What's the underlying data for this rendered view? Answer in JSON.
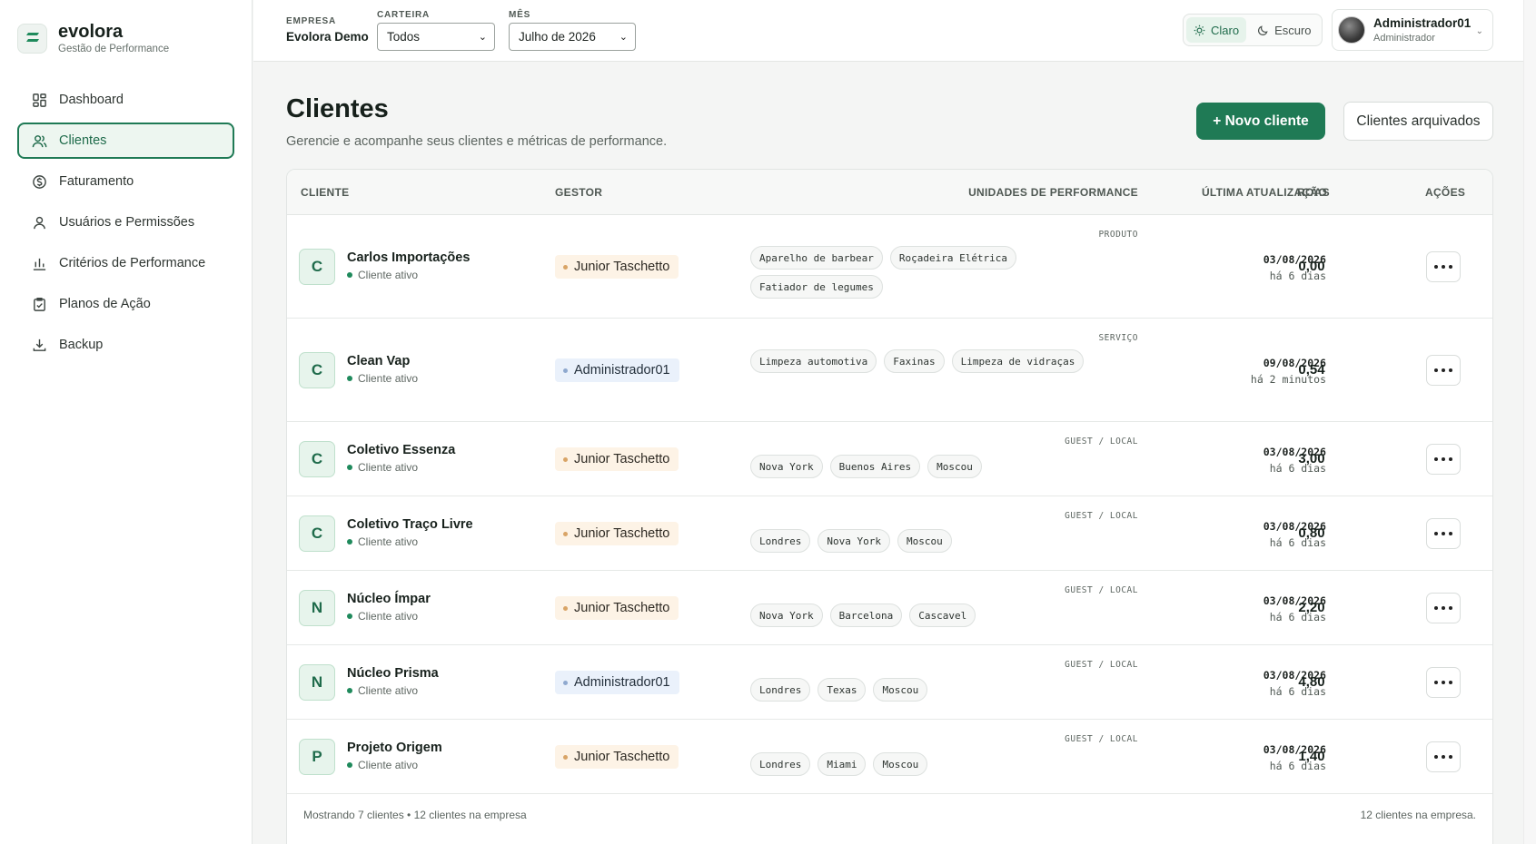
{
  "brand": {
    "name": "evolora",
    "subtitle": "Gestão de Performance"
  },
  "sidebar": {
    "items": [
      {
        "label": "Dashboard",
        "icon": "grid-icon",
        "active": false
      },
      {
        "label": "Clientes",
        "icon": "users-icon",
        "active": true
      },
      {
        "label": "Faturamento",
        "icon": "dollar-circle-icon",
        "active": false
      },
      {
        "label": "Usuários e Permissões",
        "icon": "user-icon",
        "active": false
      },
      {
        "label": "Critérios de Performance",
        "icon": "bar-chart-icon",
        "active": false
      },
      {
        "label": "Planos de Ação",
        "icon": "clipboard-check-icon",
        "active": false
      },
      {
        "label": "Backup",
        "icon": "download-icon",
        "active": false
      }
    ]
  },
  "topbar": {
    "empresa_label": "EMPRESA",
    "empresa_value": "Evolora Demo",
    "carteira_label": "CARTEIRA",
    "carteira_value": "Todos",
    "mes_label": "MÊS",
    "mes_value": "Julho de 2026",
    "theme_light": "Claro",
    "theme_dark": "Escuro",
    "user_name": "Administrador01",
    "user_role": "Administrador"
  },
  "page": {
    "title": "Clientes",
    "subtitle": "Gerencie e acompanhe seus clientes e métricas de performance.",
    "new_button": "+ Novo cliente",
    "archived_button": "Clientes arquivados"
  },
  "table": {
    "headers": {
      "cliente": "CLIENTE",
      "gestor": "GESTOR",
      "unidades": "UNIDADES DE PERFORMANCE",
      "atualizacao": "ÚLTIMA ATUALIZAÇÃO",
      "roas": "ROAS",
      "acoes": "AÇÕES"
    },
    "rows": [
      {
        "initial": "C",
        "name": "Carlos Importações",
        "status": "Cliente ativo",
        "gestor": "Junior Taschetto",
        "gestor_color": "orange",
        "unit_type": "PRODUTO",
        "units": [
          "Aparelho de barbear",
          "Roçadeira Elétrica",
          "Fatiador de legumes"
        ],
        "date": "03/08/2026",
        "ago": "há 6 dias",
        "roas": "0,00"
      },
      {
        "initial": "C",
        "name": "Clean Vap",
        "status": "Cliente ativo",
        "gestor": "Administrador01",
        "gestor_color": "blue",
        "unit_type": "SERVIÇO",
        "units": [
          "Limpeza automotiva",
          "Faxinas",
          "Limpeza de vidraças"
        ],
        "date": "09/08/2026",
        "ago": "há 2 minutos",
        "roas": "0,54"
      },
      {
        "initial": "C",
        "name": "Coletivo Essenza",
        "status": "Cliente ativo",
        "gestor": "Junior Taschetto",
        "gestor_color": "orange",
        "unit_type": "GUEST / LOCAL",
        "units": [
          "Nova York",
          "Buenos Aires",
          "Moscou"
        ],
        "date": "03/08/2026",
        "ago": "há 6 dias",
        "roas": "3,00"
      },
      {
        "initial": "C",
        "name": "Coletivo Traço Livre",
        "status": "Cliente ativo",
        "gestor": "Junior Taschetto",
        "gestor_color": "orange",
        "unit_type": "GUEST / LOCAL",
        "units": [
          "Londres",
          "Nova York",
          "Moscou"
        ],
        "date": "03/08/2026",
        "ago": "há 6 dias",
        "roas": "0,80"
      },
      {
        "initial": "N",
        "name": "Núcleo Ímpar",
        "status": "Cliente ativo",
        "gestor": "Junior Taschetto",
        "gestor_color": "orange",
        "unit_type": "GUEST / LOCAL",
        "units": [
          "Nova York",
          "Barcelona",
          "Cascavel"
        ],
        "date": "03/08/2026",
        "ago": "há 6 dias",
        "roas": "2,20"
      },
      {
        "initial": "N",
        "name": "Núcleo Prisma",
        "status": "Cliente ativo",
        "gestor": "Administrador01",
        "gestor_color": "blue",
        "unit_type": "GUEST / LOCAL",
        "units": [
          "Londres",
          "Texas",
          "Moscou"
        ],
        "date": "03/08/2026",
        "ago": "há 6 dias",
        "roas": "4,80"
      },
      {
        "initial": "P",
        "name": "Projeto Origem",
        "status": "Cliente ativo",
        "gestor": "Junior Taschetto",
        "gestor_color": "orange",
        "unit_type": "GUEST / LOCAL",
        "units": [
          "Londres",
          "Miami",
          "Moscou"
        ],
        "date": "03/08/2026",
        "ago": "há 6 dias",
        "roas": "1,40"
      }
    ],
    "footer_left": "Mostrando 7 clientes • 12 clientes na empresa",
    "footer_right": "12 clientes na empresa."
  },
  "colors": {
    "accent": "#1f7a55",
    "accent_soft": "#edf6f0"
  }
}
